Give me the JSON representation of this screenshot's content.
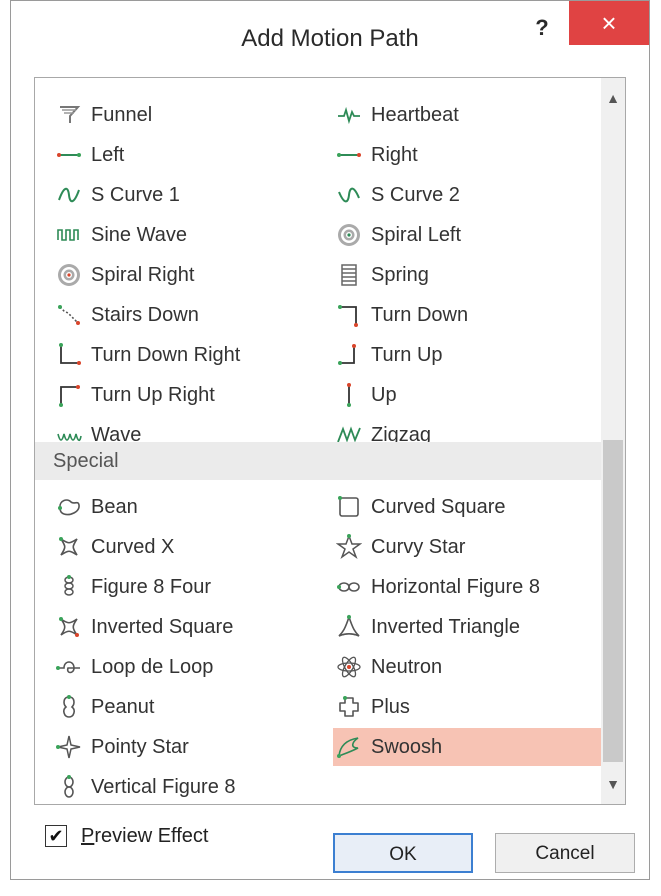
{
  "dialog": {
    "title": "Add Motion Path",
    "help_label": "?",
    "close_label": "×"
  },
  "list": {
    "basic_left": [
      {
        "label": "Funnel",
        "icon": "funnel-icon"
      },
      {
        "label": "Left",
        "icon": "left-line-icon"
      },
      {
        "label": "S Curve 1",
        "icon": "s-curve-1-icon"
      },
      {
        "label": "Sine Wave",
        "icon": "sine-wave-icon"
      },
      {
        "label": "Spiral Right",
        "icon": "spiral-right-icon"
      },
      {
        "label": "Stairs Down",
        "icon": "stairs-down-icon"
      },
      {
        "label": "Turn Down Right",
        "icon": "turn-down-right-icon"
      },
      {
        "label": "Turn Up Right",
        "icon": "turn-up-right-icon"
      },
      {
        "label": "Wave",
        "icon": "wave-icon"
      }
    ],
    "basic_right": [
      {
        "label": "Heartbeat",
        "icon": "heartbeat-icon"
      },
      {
        "label": "Right",
        "icon": "right-line-icon"
      },
      {
        "label": "S Curve 2",
        "icon": "s-curve-2-icon"
      },
      {
        "label": "Spiral Left",
        "icon": "spiral-left-icon"
      },
      {
        "label": "Spring",
        "icon": "spring-icon"
      },
      {
        "label": "Turn Down",
        "icon": "turn-down-icon"
      },
      {
        "label": "Turn Up",
        "icon": "turn-up-icon"
      },
      {
        "label": "Up",
        "icon": "up-line-icon"
      },
      {
        "label": "Zigzag",
        "icon": "zigzag-icon"
      }
    ],
    "special_header": "Special",
    "special_left": [
      {
        "label": "Bean",
        "icon": "bean-icon"
      },
      {
        "label": "Curved X",
        "icon": "curved-x-icon"
      },
      {
        "label": "Figure 8 Four",
        "icon": "figure-8-four-icon"
      },
      {
        "label": "Inverted Square",
        "icon": "inverted-square-icon"
      },
      {
        "label": "Loop de Loop",
        "icon": "loop-de-loop-icon"
      },
      {
        "label": "Peanut",
        "icon": "peanut-icon"
      },
      {
        "label": "Pointy Star",
        "icon": "pointy-star-icon"
      },
      {
        "label": "Vertical Figure 8",
        "icon": "vertical-figure-8-icon"
      }
    ],
    "special_right": [
      {
        "label": "Curved Square",
        "icon": "curved-square-icon"
      },
      {
        "label": "Curvy Star",
        "icon": "curvy-star-icon"
      },
      {
        "label": "Horizontal Figure 8",
        "icon": "horizontal-figure-8-icon"
      },
      {
        "label": "Inverted Triangle",
        "icon": "inverted-triangle-icon"
      },
      {
        "label": "Neutron",
        "icon": "neutron-icon"
      },
      {
        "label": "Plus",
        "icon": "plus-icon"
      },
      {
        "label": "Swoosh",
        "icon": "swoosh-icon"
      }
    ],
    "selected": "Swoosh",
    "selection_color": "#f7c3b4"
  },
  "footer": {
    "preview_checked": true,
    "preview_label_first": "P",
    "preview_label_rest": "review Effect",
    "ok_label": "OK",
    "cancel_label": "Cancel"
  },
  "colors": {
    "close_button": "#e04343",
    "path_line": "#2e8b57",
    "path_start": "#3aa35a",
    "path_end": "#d9452b"
  }
}
